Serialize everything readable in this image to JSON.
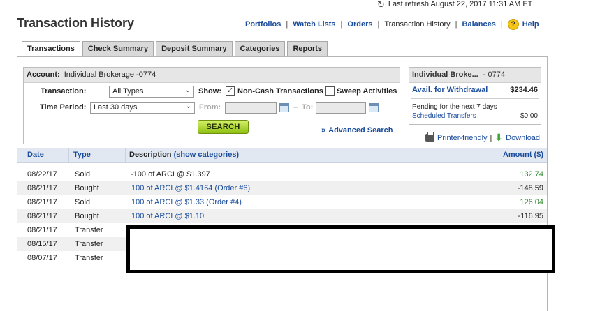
{
  "header": {
    "refresh_text": "Last refresh August 22, 2017 11:31 AM ET",
    "title": "Transaction History",
    "nav": {
      "portfolios": "Portfolios",
      "watch_lists": "Watch Lists",
      "orders": "Orders",
      "transaction_history": "Transaction History",
      "balances": "Balances",
      "help": "Help"
    }
  },
  "tabs": [
    "Transactions",
    "Check Summary",
    "Deposit Summary",
    "Categories",
    "Reports"
  ],
  "filter": {
    "account_label": "Account:",
    "account_value": "Individual Brokerage -0774",
    "transaction_label": "Transaction:",
    "transaction_value": "All Types",
    "show_label": "Show:",
    "non_cash_label": "Non-Cash Transactions",
    "non_cash_checked": true,
    "sweep_label": "Sweep Activities",
    "sweep_checked": false,
    "time_period_label": "Time Period:",
    "time_period_value": "Last 30 days",
    "from_label": "From:",
    "to_label": "To:",
    "search_button": "SEARCH",
    "advanced_search": "Advanced Search"
  },
  "summary": {
    "account_name": "Individual Broke...",
    "account_suffix": "- 0774",
    "avail_label": "Avail. for Withdrawal",
    "avail_value": "$234.46",
    "pending_text": "Pending for the next 7 days",
    "scheduled_label": "Scheduled Transfers",
    "scheduled_value": "$0.00"
  },
  "actions": {
    "printer_friendly": "Printer-friendly",
    "separator": "|",
    "download": "Download"
  },
  "table": {
    "headers": {
      "date": "Date",
      "type": "Type",
      "description": "Description",
      "show_categories": "(show categories)",
      "amount": "Amount ($)"
    },
    "rows": [
      {
        "date": "08/22/17",
        "type": "Sold",
        "description": "-100 of ARCI @ $1.397",
        "amount": "132.74"
      },
      {
        "date": "08/21/17",
        "type": "Bought",
        "description": "100 of ARCI @ $1.4164 (Order #6)",
        "amount": "-148.59"
      },
      {
        "date": "08/21/17",
        "type": "Sold",
        "description": "100 of ARCI @ $1.33 (Order #4)",
        "amount": "126.04"
      },
      {
        "date": "08/21/17",
        "type": "Bought",
        "description": "100 of ARCI @ $1.10",
        "amount": "-116.95"
      },
      {
        "date": "08/21/17",
        "type": "Transfer",
        "description": "",
        "amount": ""
      },
      {
        "date": "08/15/17",
        "type": "Transfer",
        "description": "",
        "amount": ""
      },
      {
        "date": "08/07/17",
        "type": "Transfer",
        "description": "",
        "amount": ""
      }
    ]
  },
  "colors": {
    "link": "#1a4c9c",
    "positive_amount": "#2e8b2e",
    "search_button": "#a6d22a"
  }
}
